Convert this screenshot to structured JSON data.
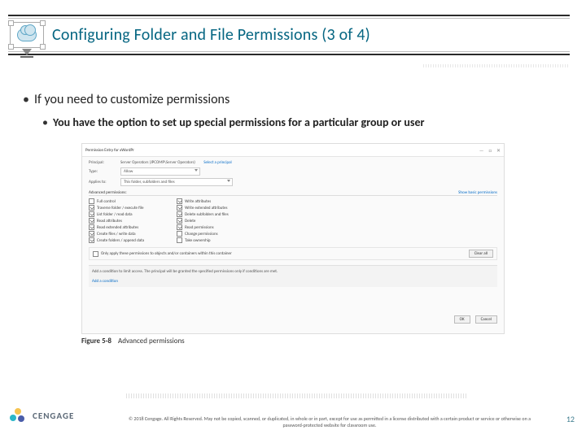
{
  "header": {
    "title": "Configuring Folder and File Permissions (3 of 4)"
  },
  "body": {
    "bullet1": "If you need to customize permissions",
    "bullet2": "You have the option to set up special permissions for a particular group or user"
  },
  "dialog": {
    "window_title": "Permission Entry for xWordPr",
    "labels": {
      "principal": "Principal:",
      "type": "Type:",
      "applies": "Applies to:"
    },
    "principal_value": "Server Operators (JPCOMP\\Server Operators)",
    "select_principal_link": "Select a principal",
    "type_value": "Allow",
    "applies_value": "This folder, subfolders and files",
    "advanced_header": "Advanced permissions:",
    "show_basic_link": "Show basic permissions",
    "permissions_left": [
      {
        "label": "Full control",
        "checked": false
      },
      {
        "label": "Traverse folder / execute file",
        "checked": true
      },
      {
        "label": "List folder / read data",
        "checked": true
      },
      {
        "label": "Read attributes",
        "checked": true
      },
      {
        "label": "Read extended attributes",
        "checked": true
      },
      {
        "label": "Create files / write data",
        "checked": true
      },
      {
        "label": "Create folders / append data",
        "checked": true
      }
    ],
    "permissions_right": [
      {
        "label": "Write attributes",
        "checked": true
      },
      {
        "label": "Write extended attributes",
        "checked": true
      },
      {
        "label": "Delete subfolders and files",
        "checked": true
      },
      {
        "label": "Delete",
        "checked": true
      },
      {
        "label": "Read permissions",
        "checked": true
      },
      {
        "label": "Change permissions",
        "checked": false
      },
      {
        "label": "Take ownership",
        "checked": false
      }
    ],
    "apply_only": "Only apply these permissions to objects and/or containers within this container",
    "clear_all_btn": "Clear all",
    "condition_text": "Add a condition to limit access. The principal will be granted the specified permissions only if conditions are met.",
    "add_condition": "Add a condition",
    "ok_btn": "OK",
    "cancel_btn": "Cancel"
  },
  "caption": {
    "figure": "Figure 5-8",
    "text": "Advanced permissions"
  },
  "footer": {
    "brand": "CENGAGE",
    "copyright": "© 2018 Cengage. All Rights Reserved. May not be copied, scanned, or duplicated, in whole or in part, except for use as permitted in a license distributed with a certain product or service or otherwise on a password-protected website for classroom use.",
    "page": "12"
  }
}
